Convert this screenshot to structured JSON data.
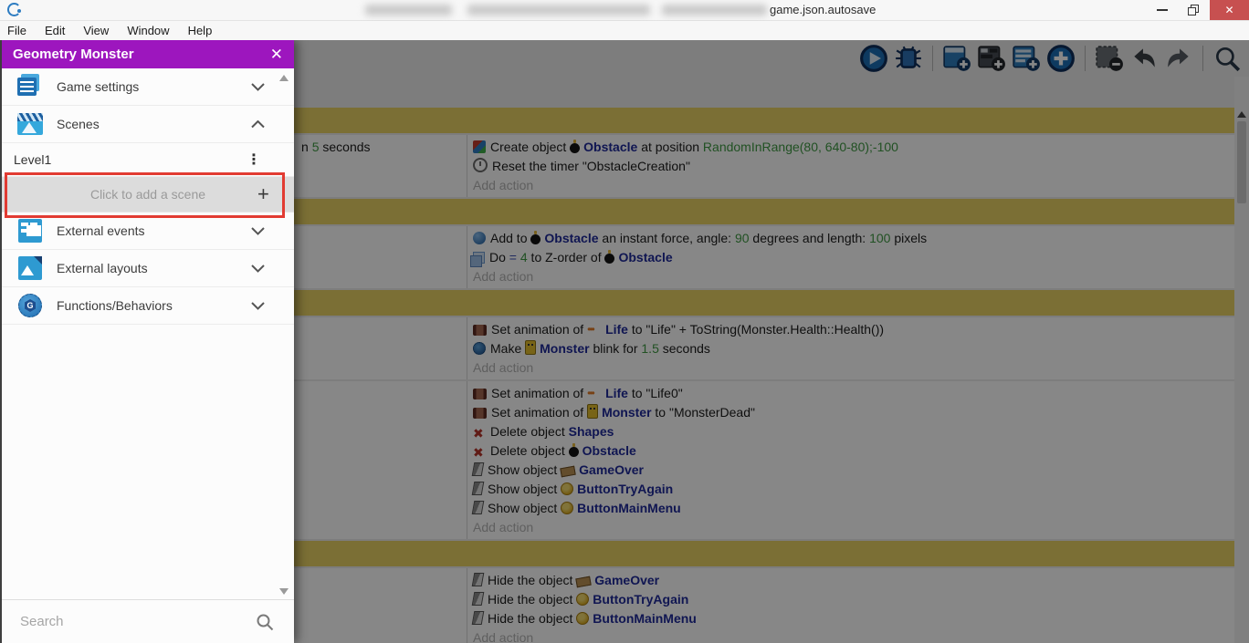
{
  "window": {
    "title_tail": "game.json.autosave",
    "controls": [
      "minimize",
      "restore",
      "close"
    ],
    "close_color": "#c75050"
  },
  "menu_bar": {
    "items": [
      "File",
      "Edit",
      "View",
      "Window",
      "Help"
    ]
  },
  "toolbar": {
    "icons": [
      "preview-play",
      "debug",
      "add-object",
      "add-objects-group",
      "add-comment",
      "add-event",
      "remove-event",
      "undo",
      "redo",
      "search"
    ]
  },
  "drawer": {
    "title": "Geometry Monster",
    "accent_color": "#9d16be",
    "sections": [
      {
        "label": "Game settings",
        "state": "collapsed"
      },
      {
        "label": "Scenes",
        "state": "expanded"
      },
      {
        "label": "External events",
        "state": "collapsed"
      },
      {
        "label": "External layouts",
        "state": "collapsed"
      },
      {
        "label": "Functions/Behaviors",
        "state": "collapsed"
      }
    ],
    "scenes_list": {
      "items": [
        {
          "label": "Level1"
        }
      ],
      "add_label": "Click to add a scene"
    },
    "search_placeholder": "Search"
  },
  "annotation": {
    "color": "#e23b32",
    "target": "Click to add a scene"
  },
  "labels": {
    "add_action": "Add action"
  },
  "events": [
    {
      "type": "group"
    },
    {
      "type": "event",
      "cond": [
        {
          "segs": [
            {
              "k": "t",
              "v": "n "
            },
            {
              "k": "g",
              "v": "5"
            },
            {
              "k": "t",
              "v": " seconds"
            }
          ]
        }
      ],
      "act": [
        {
          "icon": "create",
          "segs": [
            {
              "k": "t",
              "v": "Create object "
            },
            {
              "k": "o",
              "icon": "bomb",
              "v": "Obstacle"
            },
            {
              "k": "t",
              "v": " at position "
            },
            {
              "k": "g",
              "v": "RandomInRange(80, 640-80);-100"
            }
          ]
        },
        {
          "icon": "timer",
          "segs": [
            {
              "k": "t",
              "v": "Reset the timer \"ObstacleCreation\""
            }
          ]
        }
      ]
    },
    {
      "type": "group"
    },
    {
      "type": "event",
      "cond": [],
      "act": [
        {
          "icon": "force",
          "segs": [
            {
              "k": "t",
              "v": "Add to "
            },
            {
              "k": "o",
              "icon": "bomb",
              "v": "Obstacle"
            },
            {
              "k": "t",
              "v": " an instant force, angle: "
            },
            {
              "k": "g",
              "v": "90"
            },
            {
              "k": "t",
              "v": " degrees and length: "
            },
            {
              "k": "g",
              "v": "100"
            },
            {
              "k": "t",
              "v": " pixels"
            }
          ]
        },
        {
          "icon": "zorder",
          "segs": [
            {
              "k": "t",
              "v": "Do "
            },
            {
              "k": "eq",
              "v": "= "
            },
            {
              "k": "g",
              "v": "4"
            },
            {
              "k": "t",
              "v": " to Z-order of "
            },
            {
              "k": "o",
              "icon": "bomb",
              "v": "Obstacle"
            }
          ]
        }
      ]
    },
    {
      "type": "group"
    },
    {
      "type": "event",
      "cond": [],
      "act": [
        {
          "icon": "anim",
          "segs": [
            {
              "k": "t",
              "v": "Set animation of "
            },
            {
              "k": "o",
              "icon": "life",
              "v": "Life"
            },
            {
              "k": "t",
              "v": " to \"Life\" + ToString(Monster.Health::Health())"
            }
          ]
        },
        {
          "icon": "behavior",
          "segs": [
            {
              "k": "t",
              "v": "Make "
            },
            {
              "k": "o",
              "icon": "monster",
              "v": "Monster"
            },
            {
              "k": "t",
              "v": " blink for "
            },
            {
              "k": "g",
              "v": "1.5"
            },
            {
              "k": "t",
              "v": " seconds"
            }
          ]
        }
      ]
    },
    {
      "type": "event",
      "cond": [],
      "act": [
        {
          "icon": "anim",
          "segs": [
            {
              "k": "t",
              "v": "Set animation of "
            },
            {
              "k": "o",
              "icon": "life",
              "v": "Life"
            },
            {
              "k": "t",
              "v": " to \"Life0\""
            }
          ]
        },
        {
          "icon": "anim",
          "segs": [
            {
              "k": "t",
              "v": "Set animation of "
            },
            {
              "k": "o",
              "icon": "monster",
              "v": "Monster"
            },
            {
              "k": "t",
              "v": " to \"MonsterDead\""
            }
          ]
        },
        {
          "icon": "delete",
          "segs": [
            {
              "k": "t",
              "v": "Delete object "
            },
            {
              "k": "o",
              "v": "Shapes"
            }
          ]
        },
        {
          "icon": "delete",
          "segs": [
            {
              "k": "t",
              "v": "Delete object "
            },
            {
              "k": "o",
              "icon": "bomb",
              "v": "Obstacle"
            }
          ]
        },
        {
          "icon": "vis",
          "segs": [
            {
              "k": "t",
              "v": "Show object "
            },
            {
              "k": "o",
              "icon": "gameover",
              "v": "GameOver"
            }
          ]
        },
        {
          "icon": "vis",
          "segs": [
            {
              "k": "t",
              "v": "Show object "
            },
            {
              "k": "o",
              "icon": "button",
              "v": "ButtonTryAgain"
            }
          ]
        },
        {
          "icon": "vis",
          "segs": [
            {
              "k": "t",
              "v": "Show object "
            },
            {
              "k": "o",
              "icon": "button",
              "v": "ButtonMainMenu"
            }
          ]
        }
      ]
    },
    {
      "type": "group"
    },
    {
      "type": "event",
      "cond": [],
      "act": [
        {
          "icon": "vis",
          "segs": [
            {
              "k": "t",
              "v": "Hide the object "
            },
            {
              "k": "o",
              "icon": "gameover",
              "v": "GameOver"
            }
          ]
        },
        {
          "icon": "vis",
          "segs": [
            {
              "k": "t",
              "v": "Hide the object "
            },
            {
              "k": "o",
              "icon": "button",
              "v": "ButtonTryAgain"
            }
          ]
        },
        {
          "icon": "vis",
          "segs": [
            {
              "k": "t",
              "v": "Hide the object "
            },
            {
              "k": "o",
              "icon": "button",
              "v": "ButtonMainMenu"
            }
          ]
        }
      ]
    }
  ]
}
